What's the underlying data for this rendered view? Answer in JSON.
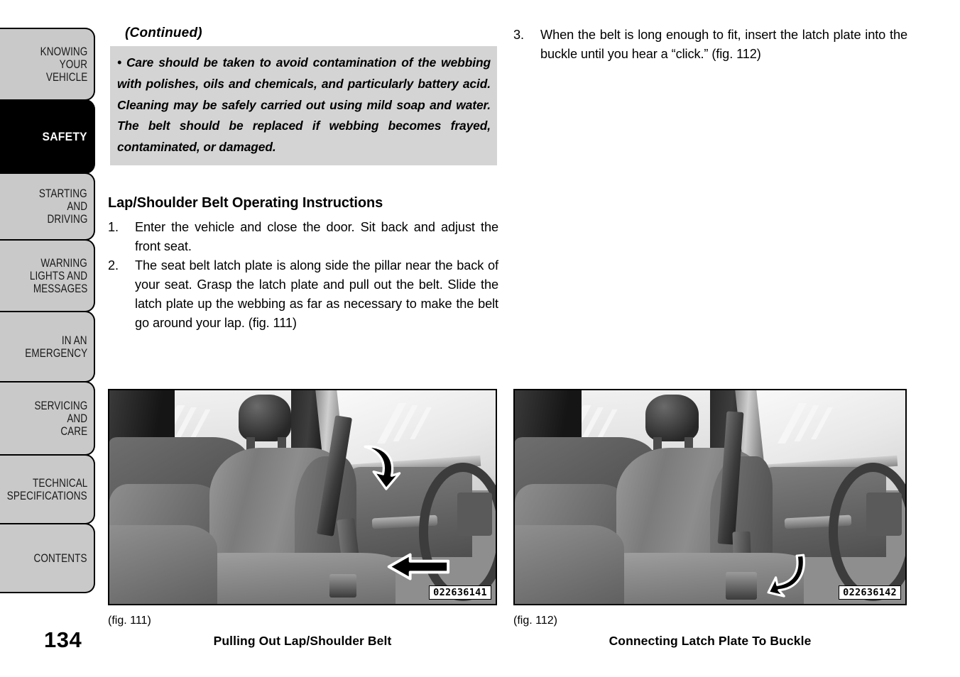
{
  "page": {
    "number": "134",
    "background": "#ffffff"
  },
  "sidebar": {
    "tabs": [
      {
        "id": "knowing-your-vehicle",
        "lines": [
          "KNOWING",
          "YOUR",
          "VEHICLE"
        ],
        "active": false
      },
      {
        "id": "safety",
        "lines": [
          "SAFETY"
        ],
        "active": true
      },
      {
        "id": "starting-and-driving",
        "lines": [
          "STARTING",
          "AND",
          "DRIVING"
        ],
        "active": false
      },
      {
        "id": "warning-lights-and-messages",
        "lines": [
          "WARNING",
          "LIGHTS AND",
          "MESSAGES"
        ],
        "active": false
      },
      {
        "id": "in-an-emergency",
        "lines": [
          "IN AN",
          "EMERGENCY"
        ],
        "active": false
      },
      {
        "id": "servicing-and-care",
        "lines": [
          "SERVICING",
          "AND",
          "CARE"
        ],
        "active": false
      },
      {
        "id": "technical-specifications",
        "lines": [
          "TECHNICAL",
          "SPECIFICATIONS"
        ],
        "active": false
      },
      {
        "id": "contents",
        "lines": [
          "CONTENTS"
        ],
        "active": false
      }
    ],
    "active_tab_colors": {
      "bg": "#000000",
      "fg": "#ffffff"
    },
    "inactive_tab_colors": {
      "bg": "#c9c9c9",
      "fg": "#1a1a1a"
    }
  },
  "left_column": {
    "continued_label": "(Continued)",
    "warning_box": {
      "background": "#d4d4d4",
      "text": "• Care should be taken to avoid contamination of the webbing with polishes, oils and chemicals, and particularly battery acid. Cleaning may be safely carried out using mild soap and water. The belt should be replaced if webbing becomes frayed, contaminated, or damaged."
    },
    "heading": "Lap/Shoulder Belt Operating Instructions",
    "steps": [
      {
        "number": "1.",
        "text": "Enter the vehicle and close the door. Sit back and adjust the front seat."
      },
      {
        "number": "2.",
        "text": "The seat belt latch plate is along side the pillar near the back of your seat. Grasp the latch plate and pull out the belt. Slide the latch plate up the webbing as far as necessary to make the belt go around your lap. (fig. 111)"
      }
    ]
  },
  "right_column": {
    "steps": [
      {
        "number": "3.",
        "text": "When the belt is long enough to fit, insert the latch plate into the buckle until you hear a “click.” (fig. 112)"
      }
    ]
  },
  "figures": [
    {
      "id": "fig-111",
      "caption": "(fig. 111)",
      "title": "Pulling Out Lap/Shoulder Belt",
      "image_id": "022636141",
      "description": "Grayscale photo of vehicle front seat interior with shoulder belt being pulled out; curved arrow at upper belt and straight arrow pointing at latch plate"
    },
    {
      "id": "fig-112",
      "caption": "(fig. 112)",
      "title": "Connecting Latch Plate To Buckle",
      "image_id": "022636142",
      "description": "Grayscale photo of vehicle front seat interior showing latch plate being connected to the buckle; curved arrow pointing down at buckle"
    }
  ]
}
